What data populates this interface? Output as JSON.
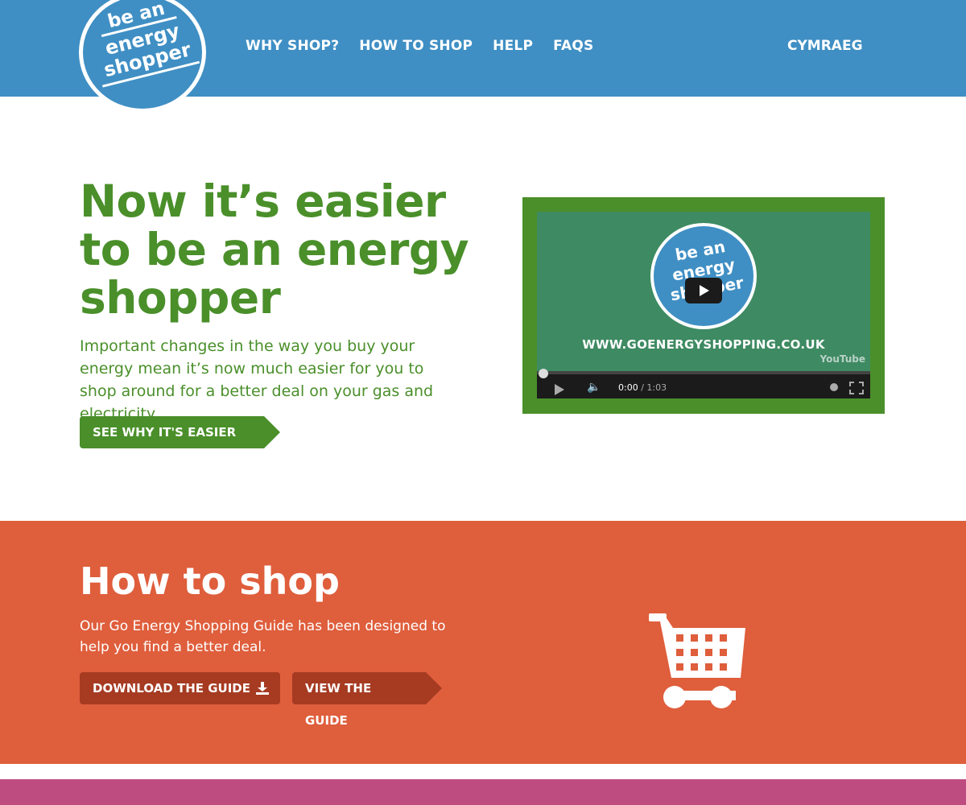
{
  "header": {
    "logo": {
      "line1": "be an",
      "line2": "energy",
      "line3": "shopper"
    },
    "nav": [
      {
        "label": "WHY SHOP?"
      },
      {
        "label": "HOW TO SHOP"
      },
      {
        "label": "HELP"
      },
      {
        "label": "FAQS"
      }
    ],
    "language_link": "CYMRAEG"
  },
  "hero": {
    "title_lines": [
      "Now it’s easier",
      "to be an energy",
      "shopper"
    ],
    "description": "Important changes in the way you buy your energy mean it’s now much easier for you to shop around for a better deal on your gas and electricity.",
    "button_label": "SEE WHY IT'S EASIER"
  },
  "video": {
    "logo_lines": [
      "be an",
      "energy",
      "shopper"
    ],
    "url_text": "WWW.GOENERGYSHOPPING.CO.UK",
    "watermark": "YouTube",
    "current_time": "0:00",
    "duration": "1:03"
  },
  "how_to_shop": {
    "title": "How to shop",
    "description": "Our Go Energy Shopping Guide has been designed to help you find a better deal.",
    "download_button": "DOWNLOAD THE GUIDE",
    "view_button": "VIEW THE GUIDE"
  },
  "colors": {
    "header_blue": "#3f8fc4",
    "hero_green": "#4a8f2a",
    "shop_orange": "#df5e3c",
    "button_dark_orange": "#a63b22",
    "footer_pink": "#bf4c80"
  },
  "icons": [
    "download-icon",
    "shopping-cart-icon",
    "play-icon",
    "volume-icon",
    "settings-icon",
    "fullscreen-icon"
  ]
}
